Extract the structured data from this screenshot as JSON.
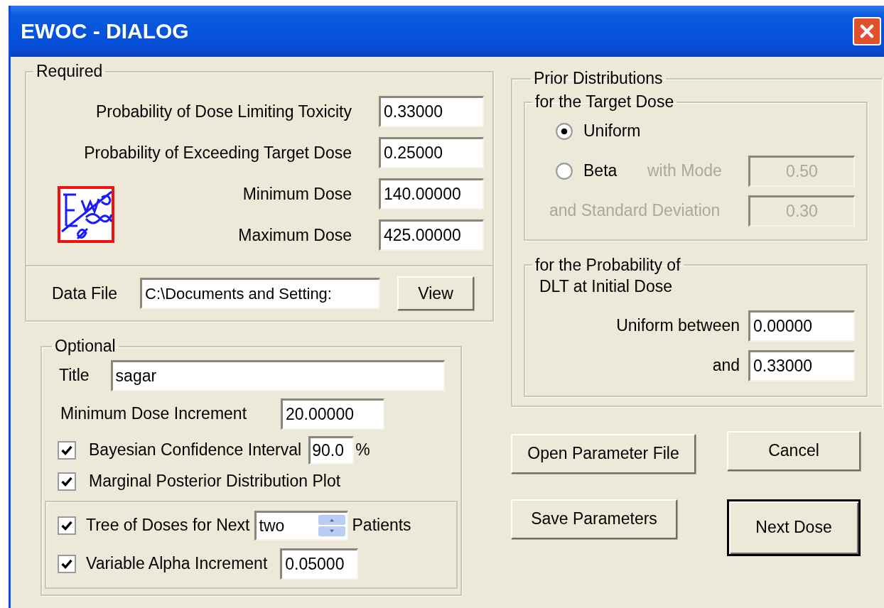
{
  "window": {
    "title": "EWOC - DIALOG"
  },
  "required": {
    "label": "Required",
    "fields": [
      {
        "label": "Probability of Dose Limiting Toxicity",
        "value": "0.33000"
      },
      {
        "label": "Probability of Exceeding Target Dose",
        "value": "0.25000"
      },
      {
        "label": "Minimum Dose",
        "value": "140.00000"
      },
      {
        "label": "Maximum Dose",
        "value": "425.00000"
      }
    ],
    "data_file": {
      "label": "Data File",
      "value": "C:\\Documents and Setting:"
    },
    "view_button": "View"
  },
  "optional": {
    "label": "Optional",
    "title": {
      "label": "Title",
      "value": "sagar"
    },
    "min_increment": {
      "label": "Minimum Dose Increment",
      "value": "20.00000"
    },
    "options": [
      {
        "kind": "field",
        "label": "Bayesian Confidence Interval",
        "checked": true,
        "value": "90.0",
        "suffix": "%"
      },
      {
        "kind": "plain",
        "label": "Marginal Posterior Distribution Plot",
        "checked": true
      }
    ],
    "tree_options": [
      {
        "kind": "spinner",
        "label": "Tree of Doses for Next",
        "checked": true,
        "value": "two",
        "suffix": "Patients"
      },
      {
        "kind": "field",
        "label": "Variable Alpha Increment",
        "checked": true,
        "value": "0.05000"
      }
    ]
  },
  "prior": {
    "label": "Prior Distributions",
    "target": {
      "label": "for the Target Dose",
      "choices": [
        {
          "label": "Uniform",
          "selected": true
        },
        {
          "label": "Beta",
          "selected": false
        }
      ],
      "mode": {
        "label": "with Mode",
        "value": "0.50",
        "disabled": true
      },
      "sd": {
        "label": "and Standard Deviation",
        "value": "0.30",
        "disabled": true
      }
    },
    "probability": {
      "label": "for the Probability of",
      "sublabel": "DLT at Initial Dose",
      "fields": [
        {
          "label": "Uniform between",
          "value": "0.00000"
        },
        {
          "label": "and",
          "value": "0.33000"
        }
      ]
    }
  },
  "buttons": [
    {
      "label": "Open Parameter File",
      "default": false
    },
    {
      "label": "Cancel",
      "default": false
    },
    {
      "label": "Save Parameters",
      "default": false
    },
    {
      "label": "Next Dose",
      "default": true
    }
  ]
}
